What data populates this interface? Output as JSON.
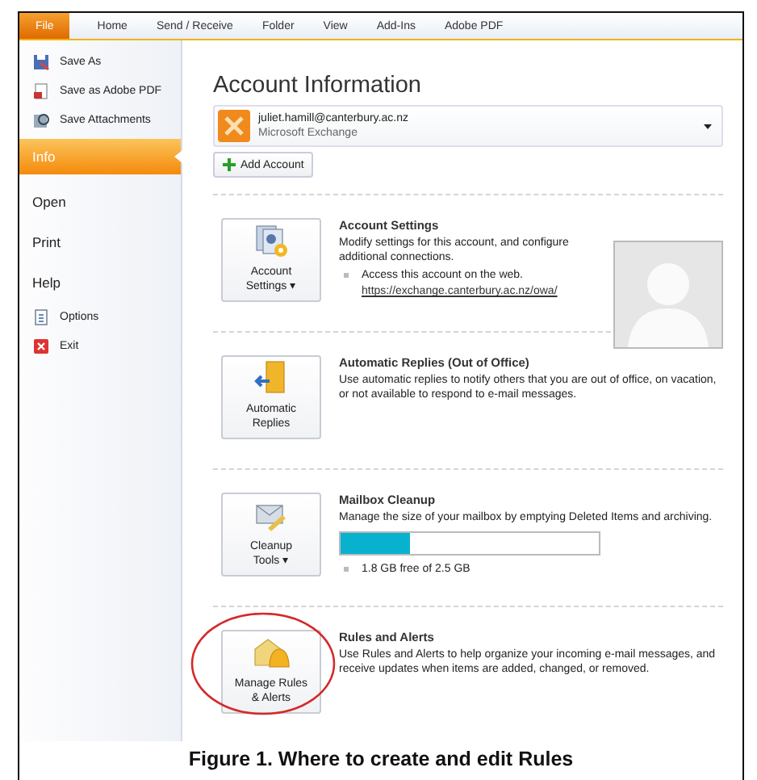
{
  "tabs": [
    {
      "label": "File",
      "selected": true
    },
    {
      "label": "Home",
      "selected": false
    },
    {
      "label": "Send / Receive",
      "selected": false
    },
    {
      "label": "Folder",
      "selected": false
    },
    {
      "label": "View",
      "selected": false
    },
    {
      "label": "Add-Ins",
      "selected": false
    },
    {
      "label": "Adobe PDF",
      "selected": false
    }
  ],
  "sidebar": {
    "items": [
      {
        "kind": "command",
        "label": "Save As",
        "selected": false
      },
      {
        "kind": "command",
        "label": "Save as Adobe PDF",
        "selected": false
      },
      {
        "kind": "command",
        "label": "Save Attachments",
        "selected": false
      },
      {
        "kind": "page",
        "label": "Info",
        "selected": true
      },
      {
        "kind": "page",
        "label": "Open",
        "selected": false
      },
      {
        "kind": "page",
        "label": "Print",
        "selected": false
      },
      {
        "kind": "page",
        "label": "Help",
        "selected": false
      },
      {
        "kind": "command",
        "label": "Options",
        "selected": false
      },
      {
        "kind": "command",
        "label": "Exit",
        "selected": false
      }
    ]
  },
  "title": "Account Information",
  "account": {
    "email": "juliet.hamill@canterbury.ac.nz",
    "type": "Microsoft Exchange"
  },
  "add_account": "Add Account",
  "sections": [
    {
      "button": [
        "Account",
        "Settings ▾"
      ],
      "heading": "Account Settings",
      "text": "Modify settings for this account, and configure additional connections.",
      "bullet": "Access this account on the web.",
      "link": "https://exchange.canterbury.ac.nz/owa/",
      "avatar": true
    },
    {
      "button": [
        "Automatic",
        "Replies"
      ],
      "heading": "Automatic Replies (Out of Office)",
      "text": "Use automatic replies to notify others that you are out of office, on vacation, or not available to respond to e-mail messages."
    },
    {
      "button": [
        "Cleanup",
        "Tools ▾"
      ],
      "heading": "Mailbox Cleanup",
      "text": "Manage the size of your mailbox by emptying Deleted Items and archiving.",
      "level": 0.27,
      "bullet": "1.8 GB free of 2.5 GB"
    },
    {
      "button": [
        "Manage Rules",
        "& Alerts"
      ],
      "heading": "Rules and Alerts",
      "text": "Use Rules and Alerts to help organize your incoming e-mail messages, and receive updates when items are added, changed, or removed.",
      "circled": true
    }
  ],
  "caption": "Figure 1. Where to create and edit Rules"
}
